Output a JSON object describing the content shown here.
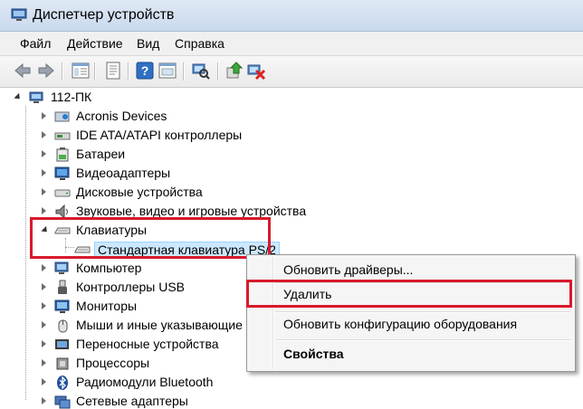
{
  "window": {
    "title": "Диспетчер устройств"
  },
  "menu": [
    "Файл",
    "Действие",
    "Вид",
    "Справка"
  ],
  "toolbar": {
    "buttons": [
      "back-icon",
      "forward-icon",
      "show-hide-tree-icon",
      "properties-icon",
      "help-icon",
      "view-icon",
      "scan-hardware-icon",
      "update-driver-icon",
      "uninstall-icon"
    ]
  },
  "tree": {
    "root": "112-ПК",
    "categories": [
      {
        "label": "Acronis Devices",
        "icon": "acronis-device-icon"
      },
      {
        "label": "IDE ATA/ATAPI контроллеры",
        "icon": "ide-controller-icon"
      },
      {
        "label": "Батареи",
        "icon": "battery-icon"
      },
      {
        "label": "Видеоадаптеры",
        "icon": "display-adapter-icon"
      },
      {
        "label": "Дисковые устройства",
        "icon": "disk-drive-icon"
      },
      {
        "label": "Звуковые, видео и игровые устройства",
        "icon": "speaker-icon"
      },
      {
        "label": "Клавиатуры",
        "icon": "keyboard-icon",
        "expanded": true
      },
      {
        "label": "Стандартная клавиатура PS/2",
        "icon": "keyboard-icon",
        "child": true,
        "selected": true
      },
      {
        "label": "Компьютер",
        "icon": "computer-icon"
      },
      {
        "label": "Контроллеры USB",
        "icon": "usb-icon"
      },
      {
        "label": "Мониторы",
        "icon": "monitor-icon"
      },
      {
        "label": "Мыши и иные указывающие",
        "icon": "mouse-icon"
      },
      {
        "label": "Переносные устройства",
        "icon": "portable-device-icon"
      },
      {
        "label": "Процессоры",
        "icon": "processor-icon"
      },
      {
        "label": "Радиомодули Bluetooth",
        "icon": "bluetooth-icon"
      },
      {
        "label": "Сетевые адаптеры",
        "icon": "network-adapter-icon"
      }
    ]
  },
  "context_menu": {
    "items": [
      "Обновить драйверы...",
      "Удалить",
      "Обновить конфигурацию оборудования",
      "Свойства"
    ],
    "highlighted": "Удалить"
  },
  "colors": {
    "highlight_box": "#d9192b",
    "selection": "#cce8ff"
  }
}
